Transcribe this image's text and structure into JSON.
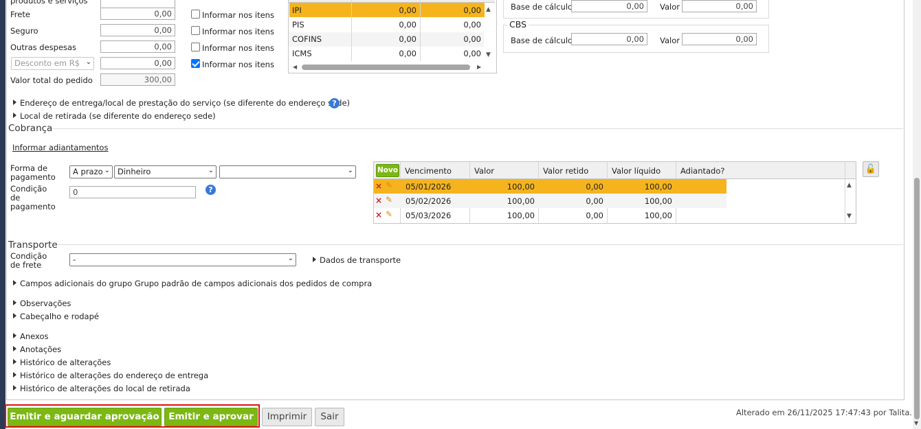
{
  "totals": {
    "top_label": "produtos e serviços",
    "rows": [
      {
        "label": "Frete",
        "value": "0,00",
        "check_label": "Informar nos itens",
        "checked": false
      },
      {
        "label": "Seguro",
        "value": "0,00",
        "check_label": "Informar nos itens",
        "checked": false
      },
      {
        "label": "Outras despesas",
        "value": "0,00",
        "check_label": "Informar nos itens",
        "checked": false
      },
      {
        "label": "Desconto em R$",
        "value": "0,00",
        "check_label": "Informar nos itens",
        "checked": true
      }
    ],
    "total_label": "Valor total do pedido",
    "total_value": "300,00"
  },
  "taxes": {
    "rows": [
      {
        "name": "IPI",
        "base": "0,00",
        "value": "0,00",
        "selected": true
      },
      {
        "name": "PIS",
        "base": "0,00",
        "value": "0,00",
        "selected": false
      },
      {
        "name": "COFINS",
        "base": "0,00",
        "value": "0,00",
        "selected": false
      },
      {
        "name": "ICMS",
        "base": "0,00",
        "value": "0,00",
        "selected": false
      }
    ]
  },
  "ibs": {
    "base_label": "Base de cálculo",
    "base_value": "0,00",
    "valor_label": "Valor",
    "valor_value": "0,00"
  },
  "cbs": {
    "title": "CBS",
    "base_label": "Base de cálculo",
    "base_value": "0,00",
    "valor_label": "Valor",
    "valor_value": "0,00"
  },
  "links": {
    "entrega": "Endereço de entrega/local de prestação do serviço (se diferente do endereço sede)",
    "retirada": "Local de retirada (se diferente do endereço sede)"
  },
  "cobranca": {
    "title": "Cobrança",
    "adiantamentos_link": "Informar adiantamentos",
    "forma_label": "Forma de pagamento",
    "forma_prazo": "A prazo",
    "forma_meio": "Dinheiro",
    "forma_extra": "",
    "condicao_label": "Condição de pagamento",
    "condicao_value": "0",
    "novo_button": "Novo",
    "columns": [
      "Vencimento",
      "Valor",
      "Valor retido",
      "Valor líquido",
      "Adiantado?"
    ],
    "rows": [
      {
        "vencimento": "05/01/2026",
        "valor": "100,00",
        "retido": "0,00",
        "liquido": "100,00",
        "adiantado": "",
        "selected": true
      },
      {
        "vencimento": "05/02/2026",
        "valor": "100,00",
        "retido": "0,00",
        "liquido": "100,00",
        "adiantado": "",
        "selected": false
      },
      {
        "vencimento": "05/03/2026",
        "valor": "100,00",
        "retido": "0,00",
        "liquido": "100,00",
        "adiantado": "",
        "selected": false
      }
    ]
  },
  "transporte": {
    "title": "Transporte",
    "condicao_label": "Condição de frete",
    "condicao_value": "-",
    "dados_link": "Dados de transporte"
  },
  "sections": [
    "Campos adicionais do grupo Grupo padrão de campos adicionais dos pedidos de compra",
    "Observações",
    "Cabeçalho e rodapé",
    "Anexos",
    "Anotações",
    "Histórico de alterações",
    "Histórico de alterações do endereço de entrega",
    "Histórico de alterações do local de retirada"
  ],
  "footer": {
    "emitir_aguardar": "Emitir e aguardar aprovação",
    "emitir_aprovar": "Emitir e aprovar",
    "imprimir": "Imprimir",
    "sair": "Sair",
    "status": "Alterado em 26/11/2025 17:47:43 por Talita."
  },
  "colors": {
    "accent_green": "#7cb814",
    "selected_row": "#f5b41e",
    "highlight_border": "#e01010",
    "help_blue": "#3a78d6"
  }
}
